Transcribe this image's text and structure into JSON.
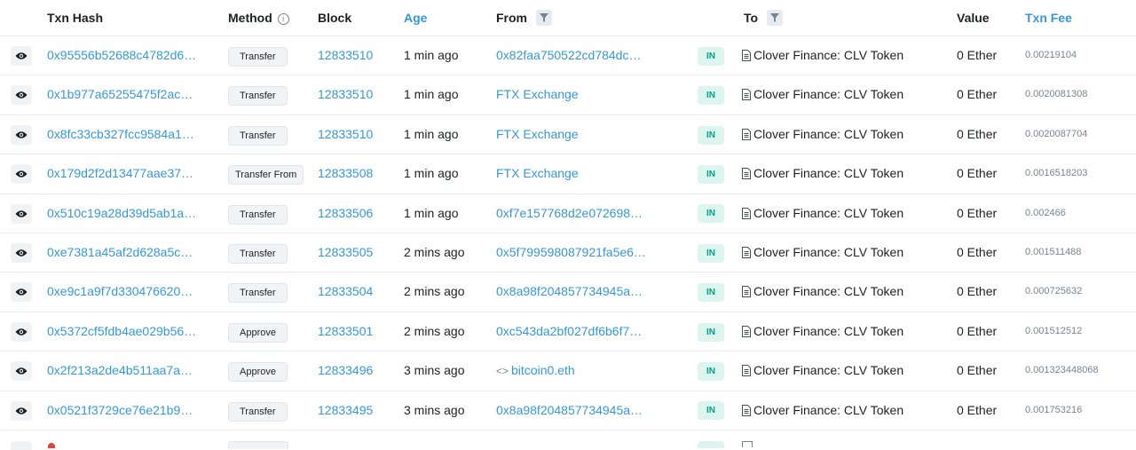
{
  "columns": {
    "txn_hash": "Txn Hash",
    "method": "Method",
    "block": "Block",
    "age": "Age",
    "from": "From",
    "to": "To",
    "value": "Value",
    "txn_fee": "Txn Fee"
  },
  "icons": {
    "view": "eye-icon",
    "method_info": "info-circle-icon",
    "filter": "filter-icon",
    "contract": "document-icon",
    "ens": "ens-icon"
  },
  "colors": {
    "link": "#3498db",
    "in_badge_bg": "#dcf5ef",
    "in_badge_text": "#00a186",
    "muted": "#77838f"
  },
  "rows": [
    {
      "hash": "0x95556b52688c4782d6…",
      "method": "Transfer",
      "block": "12833510",
      "age": "1 min ago",
      "from": "0x82faa750522cd784dc…",
      "from_ens": false,
      "direction": "IN",
      "to": "Clover Finance: CLV Token",
      "value": "0 Ether",
      "fee": "0.00219104"
    },
    {
      "hash": "0x1b977a65255475f2ac…",
      "method": "Transfer",
      "block": "12833510",
      "age": "1 min ago",
      "from": "FTX Exchange",
      "from_ens": false,
      "direction": "IN",
      "to": "Clover Finance: CLV Token",
      "value": "0 Ether",
      "fee": "0.0020081308"
    },
    {
      "hash": "0x8fc33cb327fcc9584a1…",
      "method": "Transfer",
      "block": "12833510",
      "age": "1 min ago",
      "from": "FTX Exchange",
      "from_ens": false,
      "direction": "IN",
      "to": "Clover Finance: CLV Token",
      "value": "0 Ether",
      "fee": "0.0020087704"
    },
    {
      "hash": "0x179d2f2d13477aae37…",
      "method": "Transfer From",
      "block": "12833508",
      "age": "1 min ago",
      "from": "FTX Exchange",
      "from_ens": false,
      "direction": "IN",
      "to": "Clover Finance: CLV Token",
      "value": "0 Ether",
      "fee": "0.0016518203"
    },
    {
      "hash": "0x510c19a28d39d5ab1a…",
      "method": "Transfer",
      "block": "12833506",
      "age": "1 min ago",
      "from": "0xf7e157768d2e072698…",
      "from_ens": false,
      "direction": "IN",
      "to": "Clover Finance: CLV Token",
      "value": "0 Ether",
      "fee": "0.002466"
    },
    {
      "hash": "0xe7381a45af2d628a5c…",
      "method": "Transfer",
      "block": "12833505",
      "age": "2 mins ago",
      "from": "0x5f799598087921fa5e6…",
      "from_ens": false,
      "direction": "IN",
      "to": "Clover Finance: CLV Token",
      "value": "0 Ether",
      "fee": "0.001511488"
    },
    {
      "hash": "0xe9c1a9f7d330476620…",
      "method": "Transfer",
      "block": "12833504",
      "age": "2 mins ago",
      "from": "0x8a98f204857734945a…",
      "from_ens": false,
      "direction": "IN",
      "to": "Clover Finance: CLV Token",
      "value": "0 Ether",
      "fee": "0.000725632"
    },
    {
      "hash": "0x5372cf5fdb4ae029b56…",
      "method": "Approve",
      "block": "12833501",
      "age": "2 mins ago",
      "from": "0xc543da2bf027df6b6f7…",
      "from_ens": false,
      "direction": "IN",
      "to": "Clover Finance: CLV Token",
      "value": "0 Ether",
      "fee": "0.001512512"
    },
    {
      "hash": "0x2f213a2de4b511aa7a…",
      "method": "Approve",
      "block": "12833496",
      "age": "3 mins ago",
      "from": "bitcoin0.eth",
      "from_ens": true,
      "direction": "IN",
      "to": "Clover Finance: CLV Token",
      "value": "0 Ether",
      "fee": "0.001323448068"
    },
    {
      "hash": "0x0521f3729ce76e21b9…",
      "method": "Transfer",
      "block": "12833495",
      "age": "3 mins ago",
      "from": "0x8a98f204857734945a…",
      "from_ens": false,
      "direction": "IN",
      "to": "Clover Finance: CLV Token",
      "value": "0 Ether",
      "fee": "0.001753216"
    }
  ]
}
